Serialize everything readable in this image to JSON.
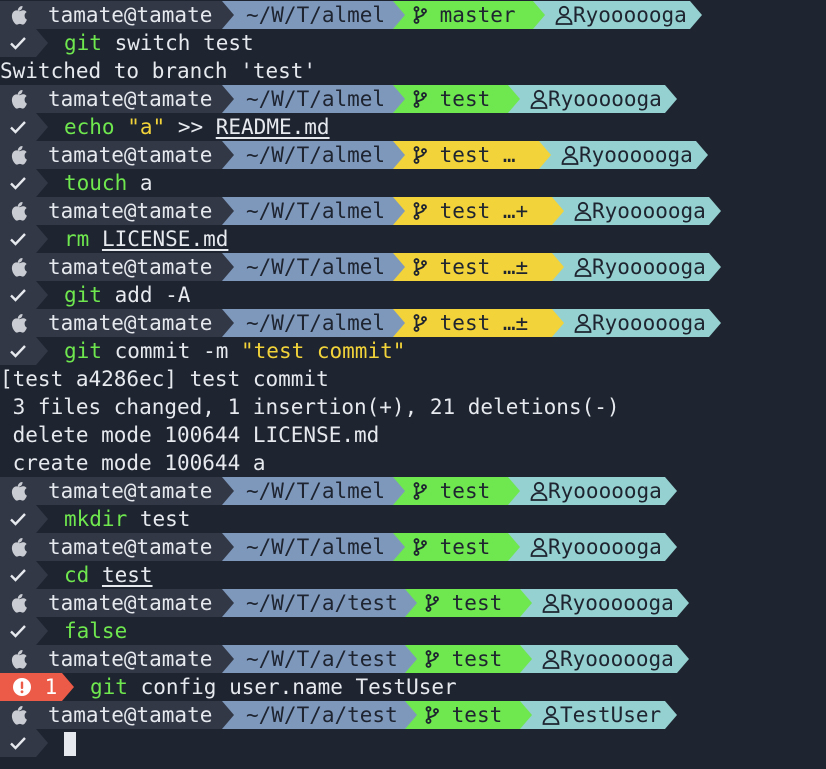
{
  "colors": {
    "background": "#1e2430",
    "segment_dark": "#323846",
    "path": "#7e98bc",
    "git_clean": "#6fe74e",
    "git_dirty": "#f2d33a",
    "user_name": "#95d1d0",
    "error": "#ec5b47",
    "command": "#6fe74e",
    "string": "#f2d33a"
  },
  "icons": {
    "os": "apple-icon",
    "branch": "git-branch-icon",
    "user": "user-icon",
    "ok": "check-icon",
    "error": "exclamation-icon"
  },
  "prompts": [
    {
      "user_host": "tamate@tamate",
      "path": "~/W/T/almel",
      "branch": "master",
      "git_status": "clean",
      "git_state": "",
      "git_user": "Ryoooooga"
    },
    {
      "user_host": "tamate@tamate",
      "path": "~/W/T/almel",
      "branch": "test",
      "git_status": "clean",
      "git_state": "",
      "git_user": "Ryoooooga"
    },
    {
      "user_host": "tamate@tamate",
      "path": "~/W/T/almel",
      "branch": "test",
      "git_status": "dirty",
      "git_state": "…",
      "git_user": "Ryoooooga"
    },
    {
      "user_host": "tamate@tamate",
      "path": "~/W/T/almel",
      "branch": "test",
      "git_status": "dirty",
      "git_state": "…+",
      "git_user": "Ryoooooga"
    },
    {
      "user_host": "tamate@tamate",
      "path": "~/W/T/almel",
      "branch": "test",
      "git_status": "dirty",
      "git_state": "…±",
      "git_user": "Ryoooooga"
    },
    {
      "user_host": "tamate@tamate",
      "path": "~/W/T/almel",
      "branch": "test",
      "git_status": "dirty",
      "git_state": "…±",
      "git_user": "Ryoooooga"
    },
    {
      "user_host": "tamate@tamate",
      "path": "~/W/T/almel",
      "branch": "test",
      "git_status": "clean",
      "git_state": "",
      "git_user": "Ryoooooga"
    },
    {
      "user_host": "tamate@tamate",
      "path": "~/W/T/almel",
      "branch": "test",
      "git_status": "clean",
      "git_state": "",
      "git_user": "Ryoooooga"
    },
    {
      "user_host": "tamate@tamate",
      "path": "~/W/T/a/test",
      "branch": "test",
      "git_status": "clean",
      "git_state": "",
      "git_user": "Ryoooooga"
    },
    {
      "user_host": "tamate@tamate",
      "path": "~/W/T/a/test",
      "branch": "test",
      "git_status": "clean",
      "git_state": "",
      "git_user": "Ryoooooga"
    },
    {
      "user_host": "tamate@tamate",
      "path": "~/W/T/a/test",
      "branch": "test",
      "git_status": "clean",
      "git_state": "",
      "git_user": "TestUser"
    }
  ],
  "commands": [
    {
      "status": "ok",
      "code": "",
      "parts": [
        {
          "t": "git",
          "c": "cmd"
        },
        {
          "t": " switch test",
          "c": "plain"
        }
      ]
    },
    {
      "status": "ok",
      "code": "",
      "parts": [
        {
          "t": "echo",
          "c": "cmd"
        },
        {
          "t": " ",
          "c": "plain"
        },
        {
          "t": "\"a\"",
          "c": "str"
        },
        {
          "t": " >> ",
          "c": "plain"
        },
        {
          "t": "README.md",
          "c": "ul"
        }
      ]
    },
    {
      "status": "ok",
      "code": "",
      "parts": [
        {
          "t": "touch",
          "c": "cmd"
        },
        {
          "t": " a",
          "c": "plain"
        }
      ]
    },
    {
      "status": "ok",
      "code": "",
      "parts": [
        {
          "t": "rm",
          "c": "cmd"
        },
        {
          "t": " ",
          "c": "plain"
        },
        {
          "t": "LICENSE.md",
          "c": "ul"
        }
      ]
    },
    {
      "status": "ok",
      "code": "",
      "parts": [
        {
          "t": "git",
          "c": "cmd"
        },
        {
          "t": " add -A",
          "c": "plain"
        }
      ]
    },
    {
      "status": "ok",
      "code": "",
      "parts": [
        {
          "t": "git",
          "c": "cmd"
        },
        {
          "t": " commit -m ",
          "c": "plain"
        },
        {
          "t": "\"test commit\"",
          "c": "str"
        }
      ]
    },
    {
      "status": "ok",
      "code": "",
      "parts": [
        {
          "t": "mkdir",
          "c": "cmd"
        },
        {
          "t": " test",
          "c": "plain"
        }
      ]
    },
    {
      "status": "ok",
      "code": "",
      "parts": [
        {
          "t": "cd",
          "c": "cmd"
        },
        {
          "t": " ",
          "c": "plain"
        },
        {
          "t": "test",
          "c": "ul"
        }
      ]
    },
    {
      "status": "ok",
      "code": "",
      "parts": [
        {
          "t": "false",
          "c": "cmd"
        }
      ]
    },
    {
      "status": "error",
      "code": "1",
      "parts": [
        {
          "t": "git",
          "c": "cmd"
        },
        {
          "t": " config user.name TestUser",
          "c": "plain"
        }
      ]
    },
    {
      "status": "ok",
      "code": "",
      "parts": []
    }
  ],
  "outputs": [
    [
      "Switched to branch 'test'"
    ],
    [],
    [],
    [],
    [],
    [
      "[test a4286ec] test commit",
      " 3 files changed, 1 insertion(+), 21 deletions(-)",
      " delete mode 100644 LICENSE.md",
      " create mode 100644 a"
    ],
    [],
    [],
    [],
    [],
    []
  ]
}
